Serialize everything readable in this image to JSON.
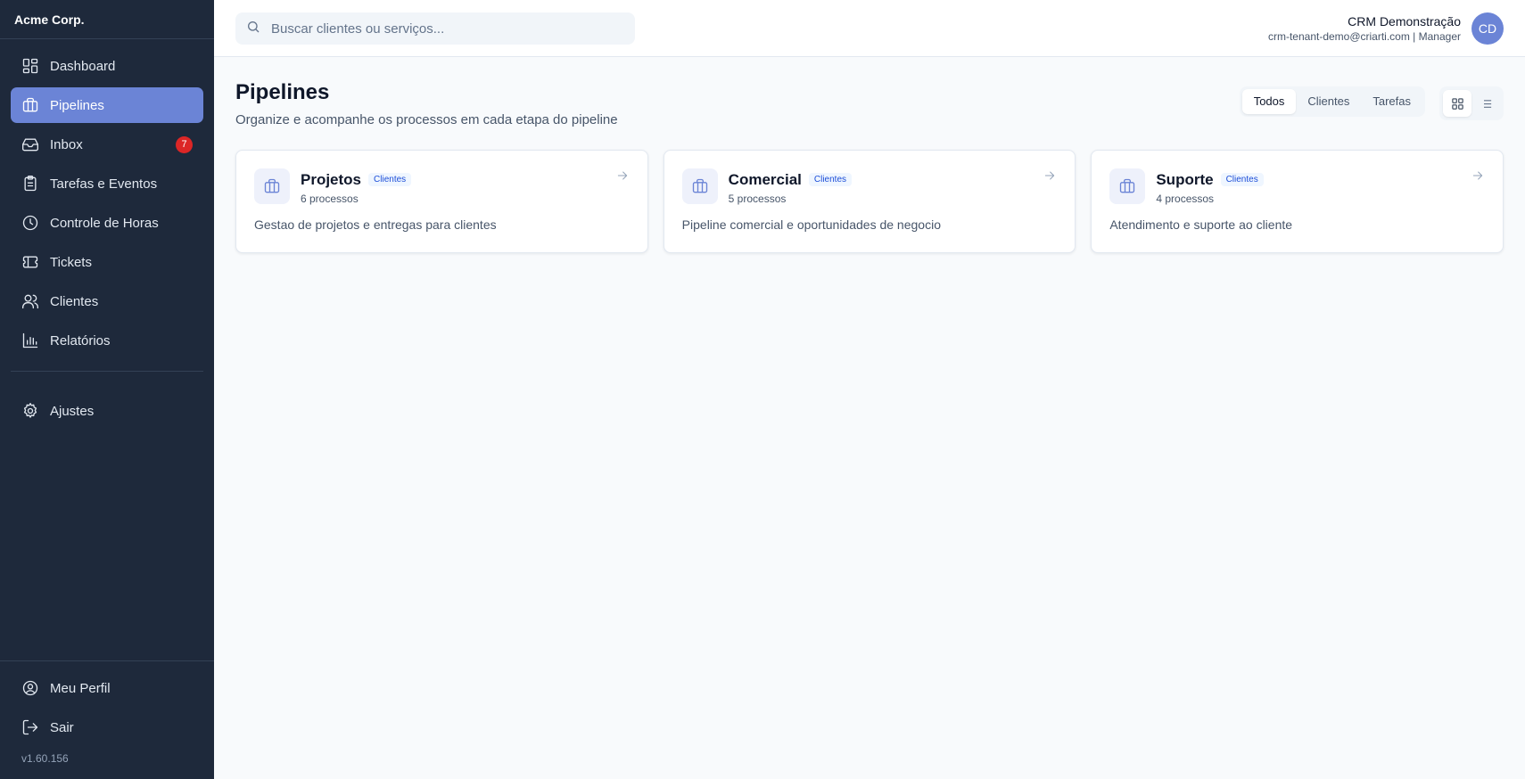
{
  "brand": "Acme Corp.",
  "sidebar": {
    "items": [
      {
        "label": "Dashboard",
        "icon": "dashboard-icon"
      },
      {
        "label": "Pipelines",
        "icon": "briefcase-icon",
        "active": true
      },
      {
        "label": "Inbox",
        "icon": "inbox-icon",
        "badge": "7"
      },
      {
        "label": "Tarefas e Eventos",
        "icon": "clipboard-icon"
      },
      {
        "label": "Controle de Horas",
        "icon": "clock-icon"
      },
      {
        "label": "Tickets",
        "icon": "ticket-icon"
      },
      {
        "label": "Clientes",
        "icon": "users-icon"
      },
      {
        "label": "Relatórios",
        "icon": "bar-chart-icon"
      }
    ],
    "settings": {
      "label": "Ajustes",
      "icon": "gear-icon"
    },
    "bottom": [
      {
        "label": "Meu Perfil",
        "icon": "user-circle-icon"
      },
      {
        "label": "Sair",
        "icon": "logout-icon"
      }
    ],
    "version": "v1.60.156"
  },
  "header": {
    "search_placeholder": "Buscar clientes ou serviços...",
    "user_name": "CRM Demonstração",
    "user_email": "crm-tenant-demo@criarti.com | Manager",
    "avatar_initials": "CD"
  },
  "page": {
    "title": "Pipelines",
    "subtitle": "Organize e acompanhe os processos em cada etapa do pipeline",
    "filters": [
      "Todos",
      "Clientes",
      "Tarefas"
    ],
    "active_filter": "Todos",
    "view_mode": "grid"
  },
  "pipelines": [
    {
      "name": "Projetos",
      "tag": "Clientes",
      "count": "6 processos",
      "description": "Gestao de projetos e entregas para clientes"
    },
    {
      "name": "Comercial",
      "tag": "Clientes",
      "count": "5 processos",
      "description": "Pipeline comercial e oportunidades de negocio"
    },
    {
      "name": "Suporte",
      "tag": "Clientes",
      "count": "4 processos",
      "description": "Atendimento e suporte ao cliente"
    }
  ],
  "colors": {
    "sidebar_bg": "#1e293b",
    "accent": "#6b84d6",
    "badge": "#dc2626"
  }
}
